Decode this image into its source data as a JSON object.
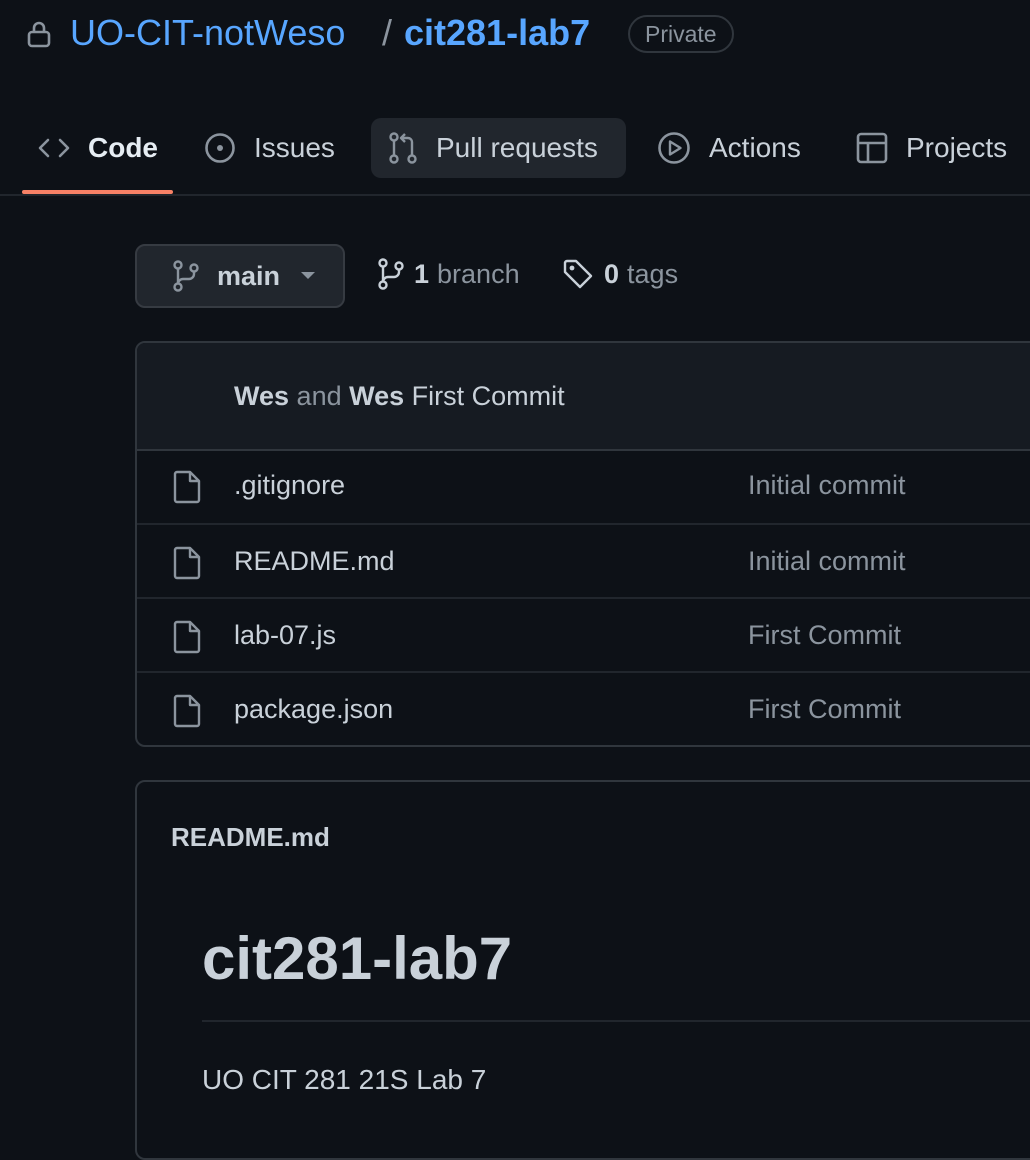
{
  "repo": {
    "owner": "UO-CIT-notWeso",
    "separator": "/",
    "name": "cit281-lab7",
    "visibility": "Private"
  },
  "tabs": [
    {
      "label": "Code",
      "icon": "code-icon",
      "selected": true
    },
    {
      "label": "Issues",
      "icon": "issue-opened-icon",
      "selected": false
    },
    {
      "label": "Pull requests",
      "icon": "git-pull-request-icon",
      "selected": false
    },
    {
      "label": "Actions",
      "icon": "play-icon",
      "selected": false
    },
    {
      "label": "Projects",
      "icon": "table-icon",
      "selected": false
    }
  ],
  "branch_selector": {
    "label": "main",
    "icon": "git-branch-icon"
  },
  "branches": {
    "count": "1",
    "label": "branch"
  },
  "tags": {
    "count": "0",
    "label": "tags"
  },
  "latest_commit": {
    "author1": "Wes",
    "joiner": "and",
    "author2": "Wes",
    "message": "First Commit"
  },
  "files": [
    {
      "name": ".gitignore",
      "commit": "Initial commit"
    },
    {
      "name": "README.md",
      "commit": "Initial commit"
    },
    {
      "name": "lab-07.js",
      "commit": "First Commit"
    },
    {
      "name": "package.json",
      "commit": "First Commit"
    }
  ],
  "readme": {
    "label": "README.md",
    "heading": "cit281-lab7",
    "body": "UO CIT 281 21S Lab 7"
  },
  "colors": {
    "background": "#0d1117",
    "link": "#58a6ff",
    "tab_underline": "#f78166",
    "muted": "#8b949e"
  }
}
